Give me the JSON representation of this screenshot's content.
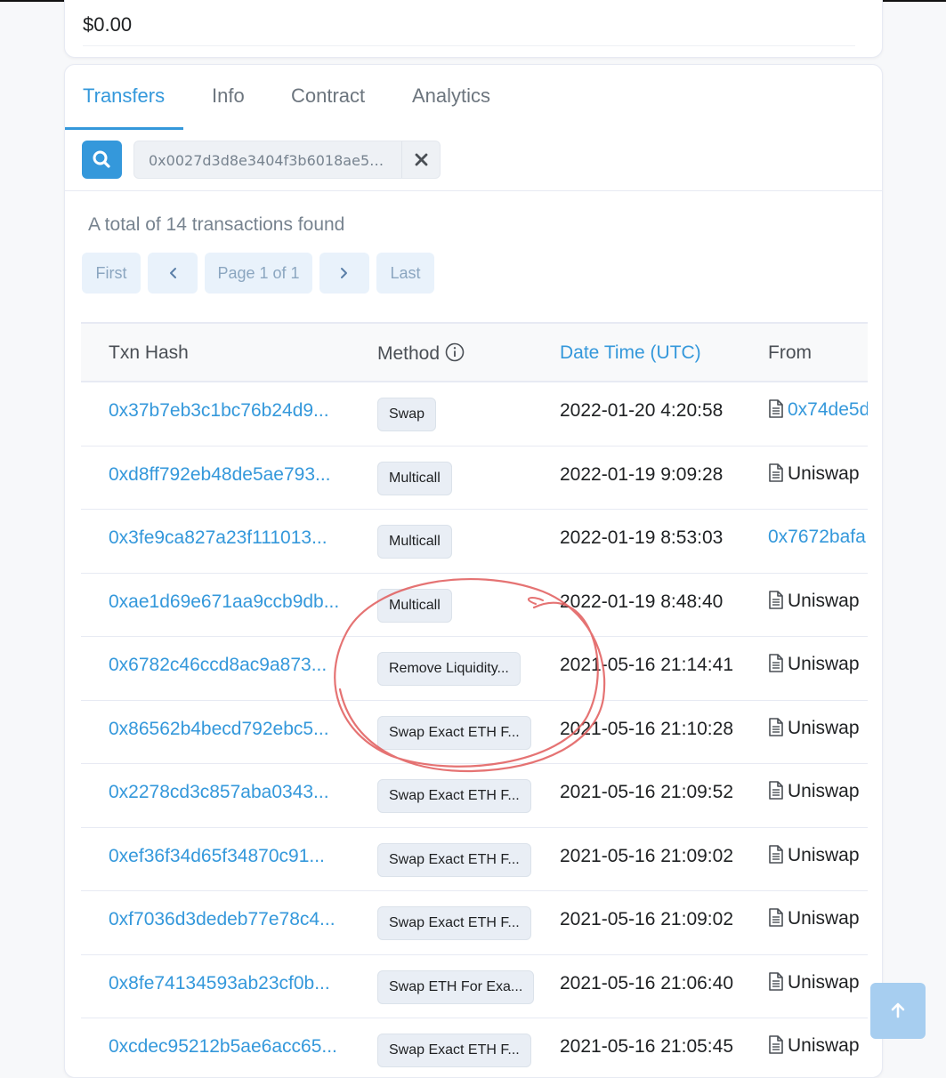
{
  "balance": {
    "value": "$0.00"
  },
  "tabs": [
    {
      "label": "Transfers",
      "active": true
    },
    {
      "label": "Info",
      "active": false
    },
    {
      "label": "Contract",
      "active": false
    },
    {
      "label": "Analytics",
      "active": false
    }
  ],
  "search": {
    "value": "0x0027d3d8e3404f3b6018ae59e9..."
  },
  "summary": {
    "text": "A total of 14 transactions found"
  },
  "pagination": {
    "first": "First",
    "page": "Page 1 of 1",
    "last": "Last"
  },
  "table": {
    "columns": {
      "hash": "Txn Hash",
      "method": "Method",
      "datetime": "Date Time (UTC)",
      "from": "From"
    },
    "rows": [
      {
        "hash": "0x37b7eb3c1bc76b24d9...",
        "method": "Swap",
        "datetime": "2022-01-20 4:20:58",
        "from": "0x74de5d",
        "from_is_contract": true,
        "from_is_link": true
      },
      {
        "hash": "0xd8ff792eb48de5ae793...",
        "method": "Multicall",
        "datetime": "2022-01-19 9:09:28",
        "from": "Uniswap",
        "from_is_contract": true,
        "from_is_link": false
      },
      {
        "hash": "0x3fe9ca827a23f111013...",
        "method": "Multicall",
        "datetime": "2022-01-19 8:53:03",
        "from": "0x7672bafa",
        "from_is_contract": false,
        "from_is_link": true
      },
      {
        "hash": "0xae1d69e671aa9ccb9db...",
        "method": "Multicall",
        "datetime": "2022-01-19 8:48:40",
        "from": "Uniswap",
        "from_is_contract": true,
        "from_is_link": false
      },
      {
        "hash": "0x6782c46ccd8ac9a873...",
        "method": "Remove Liquidity...",
        "datetime": "2021-05-16 21:14:41",
        "from": "Uniswap",
        "from_is_contract": true,
        "from_is_link": false
      },
      {
        "hash": "0x86562b4becd792ebc5...",
        "method": "Swap Exact ETH F...",
        "datetime": "2021-05-16 21:10:28",
        "from": "Uniswap",
        "from_is_contract": true,
        "from_is_link": false
      },
      {
        "hash": "0x2278cd3c857aba0343...",
        "method": "Swap Exact ETH F...",
        "datetime": "2021-05-16 21:09:52",
        "from": "Uniswap",
        "from_is_contract": true,
        "from_is_link": false
      },
      {
        "hash": "0xef36f34d65f34870c91...",
        "method": "Swap Exact ETH F...",
        "datetime": "2021-05-16 21:09:02",
        "from": "Uniswap",
        "from_is_contract": true,
        "from_is_link": false
      },
      {
        "hash": "0xf7036d3dedeb77e78c4...",
        "method": "Swap Exact ETH F...",
        "datetime": "2021-05-16 21:09:02",
        "from": "Uniswap",
        "from_is_contract": true,
        "from_is_link": false
      },
      {
        "hash": "0x8fe74134593ab23cf0b...",
        "method": "Swap ETH For Exa...",
        "datetime": "2021-05-16 21:06:40",
        "from": "Uniswap",
        "from_is_contract": true,
        "from_is_link": false
      },
      {
        "hash": "0xcdec95212b5ae6acc65...",
        "method": "Swap Exact ETH F...",
        "datetime": "2021-05-16 21:05:45",
        "from": "Uniswap",
        "from_is_contract": true,
        "from_is_link": false
      }
    ]
  },
  "colors": {
    "accent": "#3498db",
    "annotation": "#e05a5a"
  }
}
